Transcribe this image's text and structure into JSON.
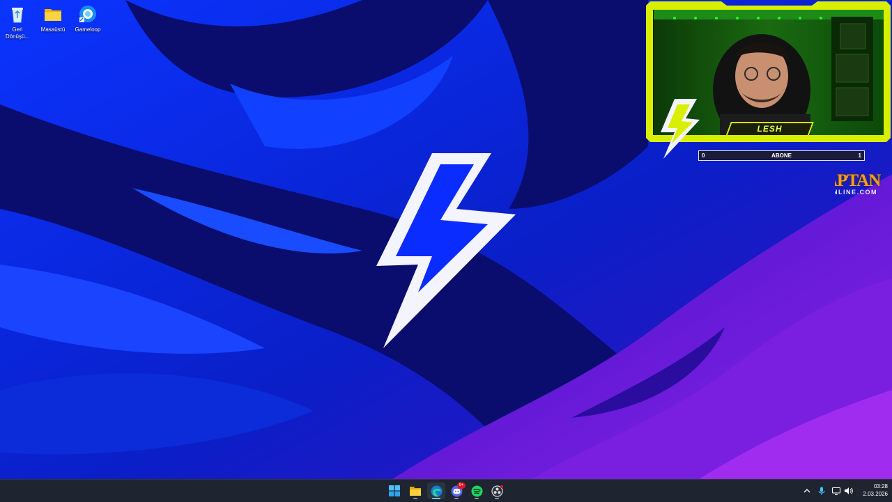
{
  "desktop": {
    "icons": [
      {
        "label": "Geri Dönüşü...",
        "icon": "recycle-bin-icon"
      },
      {
        "label": "Masaüstü",
        "icon": "folder-icon"
      },
      {
        "label": "Gameloop",
        "icon": "gameloop-icon"
      }
    ],
    "wallpaper": {
      "icon": "lightning-bolt-icon",
      "colors": {
        "primary": "#0a2cff",
        "dark": "#0a0d6e",
        "purple": "#7a1fe0"
      }
    }
  },
  "overlay": {
    "streamer_name": "LESH",
    "sub_goal": {
      "label": "ABONE",
      "current": "0",
      "target": "1"
    },
    "frame_color": "#d8f000",
    "sponsor": {
      "line1": "APTAN",
      "line2": "NLINE.COM"
    }
  },
  "taskbar": {
    "apps": [
      {
        "name": "Start",
        "icon": "windows-start-icon"
      },
      {
        "name": "File Explorer",
        "icon": "folder-icon"
      },
      {
        "name": "Microsoft Edge",
        "icon": "edge-icon"
      },
      {
        "name": "Discord",
        "icon": "discord-icon",
        "badge": "9+"
      },
      {
        "name": "Spotify",
        "icon": "spotify-icon"
      },
      {
        "name": "OBS",
        "icon": "obs-icon"
      }
    ],
    "tray": [
      "chevron-up-icon",
      "microphone-icon",
      "display-icon",
      "speaker-icon"
    ],
    "clock": {
      "time": "03:28",
      "date": "2.03.2026"
    }
  }
}
